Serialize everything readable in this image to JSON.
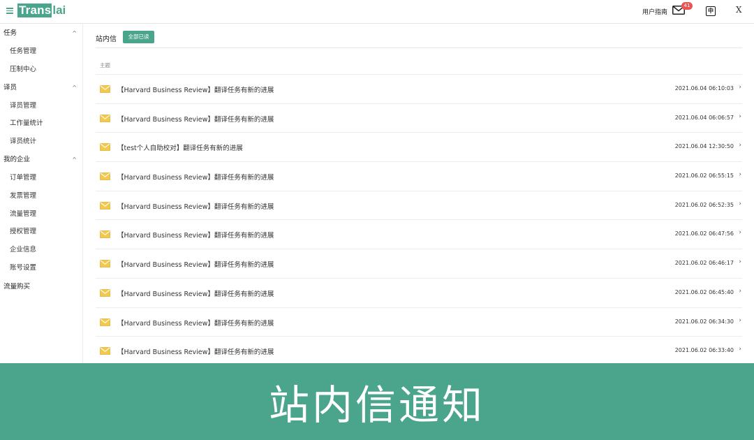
{
  "header": {
    "logo_part1": "Trans",
    "logo_part2": "lai",
    "guide_label": "用户指南",
    "mail_badge": "41",
    "lang_label": "中",
    "translate_glyph": "X"
  },
  "sidebar": {
    "groups": [
      {
        "label": "任务",
        "items": [
          "任务管理",
          "压制中心"
        ]
      },
      {
        "label": "译员",
        "items": [
          "译员管理",
          "工作量统计",
          "译员统计"
        ]
      },
      {
        "label": "我的企业",
        "items": [
          "订单管理",
          "发票管理",
          "流量管理",
          "授权管理",
          "企业信息",
          "账号设置"
        ]
      }
    ],
    "single_item": "流量购买"
  },
  "main": {
    "title": "站内信",
    "mark_all_read": "全部已读",
    "column_subject": "主题",
    "messages": [
      {
        "subject": "【Harvard Business Review】翻译任务有新的进展",
        "time": "2021.06.04 06:10:03"
      },
      {
        "subject": "【Harvard Business Review】翻译任务有新的进展",
        "time": "2021.06.04 06:06:57"
      },
      {
        "subject": "【test个人自助校对】翻译任务有新的进展",
        "time": "2021.06.04 12:30:50"
      },
      {
        "subject": "【Harvard Business Review】翻译任务有新的进展",
        "time": "2021.06.02 06:55:15"
      },
      {
        "subject": "【Harvard Business Review】翻译任务有新的进展",
        "time": "2021.06.02 06:52:35"
      },
      {
        "subject": "【Harvard Business Review】翻译任务有新的进展",
        "time": "2021.06.02 06:47:56"
      },
      {
        "subject": "【Harvard Business Review】翻译任务有新的进展",
        "time": "2021.06.02 06:46:17"
      },
      {
        "subject": "【Harvard Business Review】翻译任务有新的进展",
        "time": "2021.06.02 06:45:40"
      },
      {
        "subject": "【Harvard Business Review】翻译任务有新的进展",
        "time": "2021.06.02 06:34:30"
      },
      {
        "subject": "【Harvard Business Review】翻译任务有新的进展",
        "time": "2021.06.02 06:33:40"
      }
    ]
  },
  "banner": {
    "text": "站内信通知"
  },
  "colors": {
    "brand": "#4ba48c",
    "badge": "#e85454",
    "envelope": "#f2c94c"
  },
  "icons": {
    "menu": "hamburger-icon",
    "mail": "mail-icon",
    "envelope": "envelope-icon",
    "chevron": "chevron-up-icon",
    "arrow": "chevron-right-icon"
  }
}
